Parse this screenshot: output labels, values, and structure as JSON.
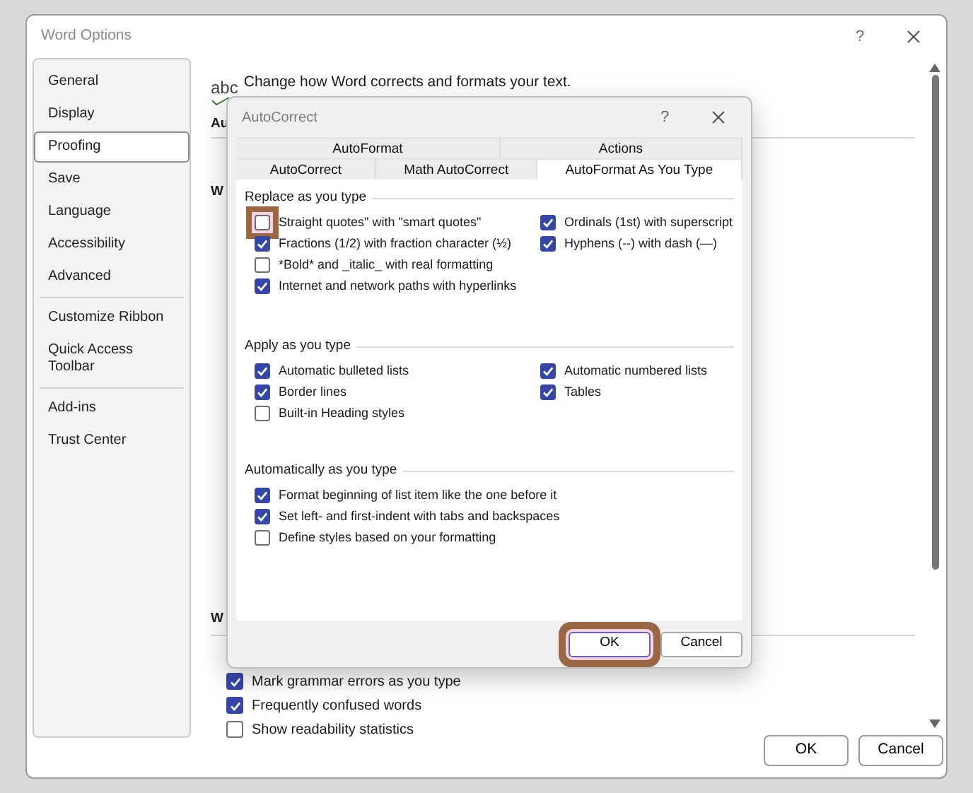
{
  "window": {
    "title": "Word Options",
    "help": "?"
  },
  "sidebar": {
    "groups": [
      [
        {
          "label": "General",
          "selected": false
        },
        {
          "label": "Display",
          "selected": false
        },
        {
          "label": "Proofing",
          "selected": true
        },
        {
          "label": "Save",
          "selected": false
        },
        {
          "label": "Language",
          "selected": false
        },
        {
          "label": "Accessibility",
          "selected": false
        },
        {
          "label": "Advanced",
          "selected": false
        }
      ],
      [
        {
          "label": "Customize Ribbon",
          "selected": false
        },
        {
          "label": "Quick Access Toolbar",
          "selected": false
        }
      ],
      [
        {
          "label": "Add-ins",
          "selected": false
        },
        {
          "label": "Trust Center",
          "selected": false
        }
      ]
    ]
  },
  "content": {
    "icon_text": "abc",
    "intro": "Change how Word corrects and formats your text.",
    "heading_1": "Au",
    "heading_2": "W",
    "heading_3": "W",
    "options": [
      {
        "label": "Mark grammar errors as you type",
        "checked": true
      },
      {
        "label": "Frequently confused words",
        "checked": true
      },
      {
        "label": "Show readability statistics",
        "checked": false
      }
    ]
  },
  "buttons": [
    {
      "label": "OK"
    },
    {
      "label": "Cancel"
    }
  ],
  "dialog": {
    "title": "AutoCorrect",
    "help": "?",
    "tab_rows": [
      [
        {
          "label": "AutoFormat",
          "selected": false
        },
        {
          "label": "Actions",
          "selected": false
        }
      ],
      [
        {
          "label": "AutoCorrect",
          "selected": false
        },
        {
          "label": "Math AutoCorrect",
          "selected": false
        },
        {
          "label": "AutoFormat As You Type",
          "selected": true
        }
      ]
    ],
    "sections": [
      {
        "heading": "Replace as you type",
        "left": [
          {
            "label": "Straight quotes\" with \"smart quotes\"",
            "checked": false,
            "highlighted": true
          },
          {
            "label": "Fractions (1/2) with fraction character (½)",
            "checked": true,
            "highlighted": false
          },
          {
            "label": "*Bold* and _italic_ with real formatting",
            "checked": false,
            "highlighted": false
          },
          {
            "label": "Internet and network paths with hyperlinks",
            "checked": true,
            "highlighted": false
          }
        ],
        "right": [
          {
            "label": "Ordinals (1st) with superscript",
            "checked": true,
            "highlighted": false
          },
          {
            "label": "Hyphens (--) with dash (—)",
            "checked": true,
            "highlighted": false
          }
        ]
      },
      {
        "heading": "Apply as you type",
        "left": [
          {
            "label": "Automatic bulleted lists",
            "checked": true,
            "highlighted": false
          },
          {
            "label": "Border lines",
            "checked": true,
            "highlighted": false
          },
          {
            "label": "Built-in Heading styles",
            "checked": false,
            "highlighted": false
          }
        ],
        "right": [
          {
            "label": "Automatic numbered lists",
            "checked": true,
            "highlighted": false
          },
          {
            "label": "Tables",
            "checked": true,
            "highlighted": false
          }
        ]
      },
      {
        "heading": "Automatically as you type",
        "left": [
          {
            "label": "Format beginning of list item like the one before it",
            "checked": true,
            "highlighted": false
          },
          {
            "label": "Set left- and first-indent with tabs and backspaces",
            "checked": true,
            "highlighted": false
          },
          {
            "label": "Define styles based on your formatting",
            "checked": false,
            "highlighted": false
          }
        ]
      }
    ],
    "buttons": [
      {
        "label": "OK",
        "highlighted": true
      },
      {
        "label": "Cancel",
        "highlighted": false
      }
    ]
  }
}
